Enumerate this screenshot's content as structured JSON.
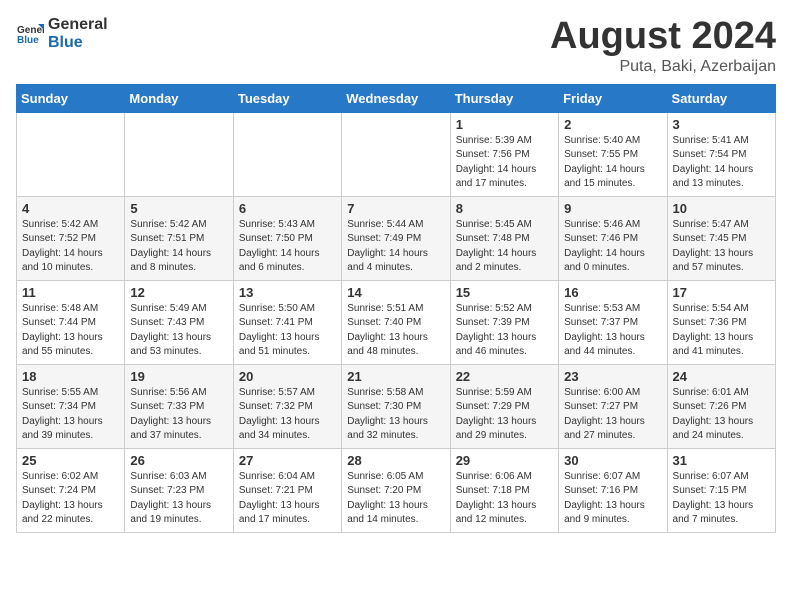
{
  "logo": {
    "general": "General",
    "blue": "Blue"
  },
  "title": "August 2024",
  "subtitle": "Puta, Baki, Azerbaijan",
  "weekdays": [
    "Sunday",
    "Monday",
    "Tuesday",
    "Wednesday",
    "Thursday",
    "Friday",
    "Saturday"
  ],
  "weeks": [
    [
      {
        "day": "",
        "info": ""
      },
      {
        "day": "",
        "info": ""
      },
      {
        "day": "",
        "info": ""
      },
      {
        "day": "",
        "info": ""
      },
      {
        "day": "1",
        "info": "Sunrise: 5:39 AM\nSunset: 7:56 PM\nDaylight: 14 hours\nand 17 minutes."
      },
      {
        "day": "2",
        "info": "Sunrise: 5:40 AM\nSunset: 7:55 PM\nDaylight: 14 hours\nand 15 minutes."
      },
      {
        "day": "3",
        "info": "Sunrise: 5:41 AM\nSunset: 7:54 PM\nDaylight: 14 hours\nand 13 minutes."
      }
    ],
    [
      {
        "day": "4",
        "info": "Sunrise: 5:42 AM\nSunset: 7:52 PM\nDaylight: 14 hours\nand 10 minutes."
      },
      {
        "day": "5",
        "info": "Sunrise: 5:42 AM\nSunset: 7:51 PM\nDaylight: 14 hours\nand 8 minutes."
      },
      {
        "day": "6",
        "info": "Sunrise: 5:43 AM\nSunset: 7:50 PM\nDaylight: 14 hours\nand 6 minutes."
      },
      {
        "day": "7",
        "info": "Sunrise: 5:44 AM\nSunset: 7:49 PM\nDaylight: 14 hours\nand 4 minutes."
      },
      {
        "day": "8",
        "info": "Sunrise: 5:45 AM\nSunset: 7:48 PM\nDaylight: 14 hours\nand 2 minutes."
      },
      {
        "day": "9",
        "info": "Sunrise: 5:46 AM\nSunset: 7:46 PM\nDaylight: 14 hours\nand 0 minutes."
      },
      {
        "day": "10",
        "info": "Sunrise: 5:47 AM\nSunset: 7:45 PM\nDaylight: 13 hours\nand 57 minutes."
      }
    ],
    [
      {
        "day": "11",
        "info": "Sunrise: 5:48 AM\nSunset: 7:44 PM\nDaylight: 13 hours\nand 55 minutes."
      },
      {
        "day": "12",
        "info": "Sunrise: 5:49 AM\nSunset: 7:43 PM\nDaylight: 13 hours\nand 53 minutes."
      },
      {
        "day": "13",
        "info": "Sunrise: 5:50 AM\nSunset: 7:41 PM\nDaylight: 13 hours\nand 51 minutes."
      },
      {
        "day": "14",
        "info": "Sunrise: 5:51 AM\nSunset: 7:40 PM\nDaylight: 13 hours\nand 48 minutes."
      },
      {
        "day": "15",
        "info": "Sunrise: 5:52 AM\nSunset: 7:39 PM\nDaylight: 13 hours\nand 46 minutes."
      },
      {
        "day": "16",
        "info": "Sunrise: 5:53 AM\nSunset: 7:37 PM\nDaylight: 13 hours\nand 44 minutes."
      },
      {
        "day": "17",
        "info": "Sunrise: 5:54 AM\nSunset: 7:36 PM\nDaylight: 13 hours\nand 41 minutes."
      }
    ],
    [
      {
        "day": "18",
        "info": "Sunrise: 5:55 AM\nSunset: 7:34 PM\nDaylight: 13 hours\nand 39 minutes."
      },
      {
        "day": "19",
        "info": "Sunrise: 5:56 AM\nSunset: 7:33 PM\nDaylight: 13 hours\nand 37 minutes."
      },
      {
        "day": "20",
        "info": "Sunrise: 5:57 AM\nSunset: 7:32 PM\nDaylight: 13 hours\nand 34 minutes."
      },
      {
        "day": "21",
        "info": "Sunrise: 5:58 AM\nSunset: 7:30 PM\nDaylight: 13 hours\nand 32 minutes."
      },
      {
        "day": "22",
        "info": "Sunrise: 5:59 AM\nSunset: 7:29 PM\nDaylight: 13 hours\nand 29 minutes."
      },
      {
        "day": "23",
        "info": "Sunrise: 6:00 AM\nSunset: 7:27 PM\nDaylight: 13 hours\nand 27 minutes."
      },
      {
        "day": "24",
        "info": "Sunrise: 6:01 AM\nSunset: 7:26 PM\nDaylight: 13 hours\nand 24 minutes."
      }
    ],
    [
      {
        "day": "25",
        "info": "Sunrise: 6:02 AM\nSunset: 7:24 PM\nDaylight: 13 hours\nand 22 minutes."
      },
      {
        "day": "26",
        "info": "Sunrise: 6:03 AM\nSunset: 7:23 PM\nDaylight: 13 hours\nand 19 minutes."
      },
      {
        "day": "27",
        "info": "Sunrise: 6:04 AM\nSunset: 7:21 PM\nDaylight: 13 hours\nand 17 minutes."
      },
      {
        "day": "28",
        "info": "Sunrise: 6:05 AM\nSunset: 7:20 PM\nDaylight: 13 hours\nand 14 minutes."
      },
      {
        "day": "29",
        "info": "Sunrise: 6:06 AM\nSunset: 7:18 PM\nDaylight: 13 hours\nand 12 minutes."
      },
      {
        "day": "30",
        "info": "Sunrise: 6:07 AM\nSunset: 7:16 PM\nDaylight: 13 hours\nand 9 minutes."
      },
      {
        "day": "31",
        "info": "Sunrise: 6:07 AM\nSunset: 7:15 PM\nDaylight: 13 hours\nand 7 minutes."
      }
    ]
  ]
}
